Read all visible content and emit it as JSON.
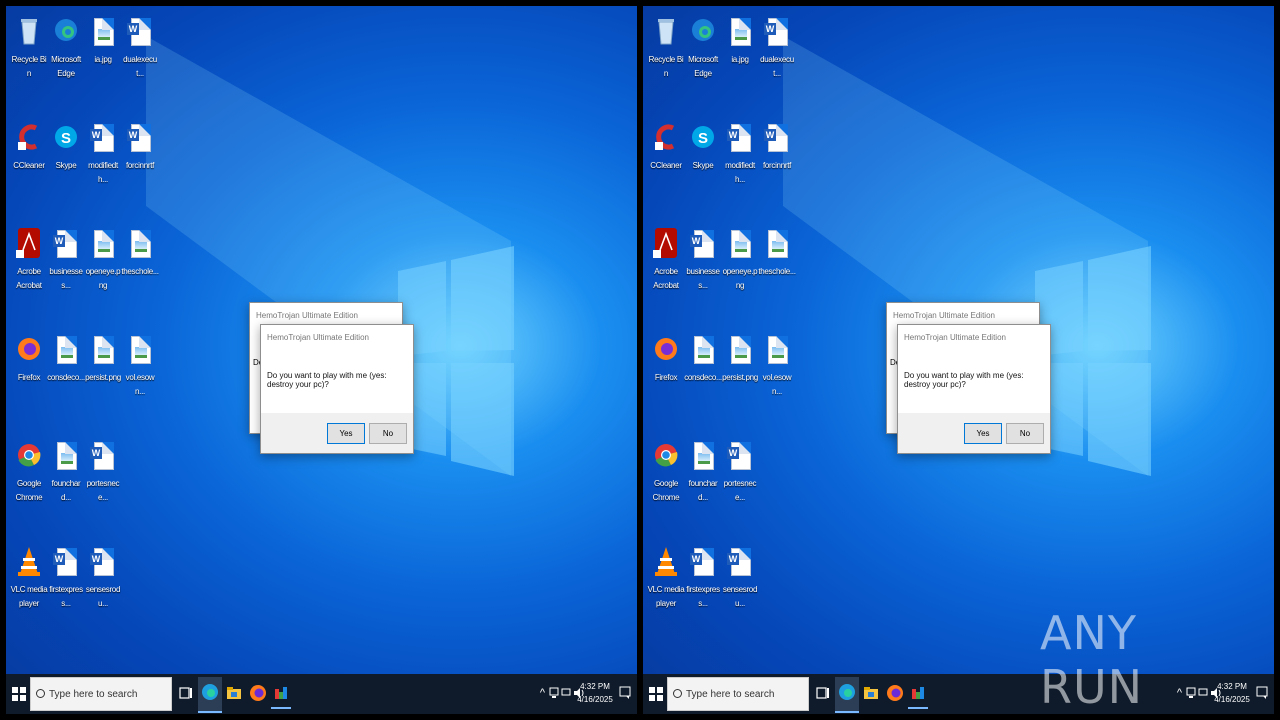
{
  "desktop_icons": [
    {
      "id": "recycle-bin",
      "lines": [
        "Recycle Bin"
      ],
      "icon": "recycle-bin-icon"
    },
    {
      "id": "edge",
      "lines": [
        "Microsoft",
        "Edge"
      ],
      "icon": "edge-icon"
    },
    {
      "id": "ia-jpg",
      "lines": [
        "ia.jpg"
      ],
      "icon": "image-file-icon"
    },
    {
      "id": "doc-dualexecut",
      "lines": [
        "dualexecut..."
      ],
      "icon": "word-file-icon"
    },
    {
      "id": "ccleaner",
      "lines": [
        "CCleaner"
      ],
      "icon": "ccleaner-icon"
    },
    {
      "id": "skype",
      "lines": [
        "Skype"
      ],
      "icon": "skype-icon"
    },
    {
      "id": "doc-modifiedth",
      "lines": [
        "modifiedth..."
      ],
      "icon": "word-file-icon"
    },
    {
      "id": "doc-forcing",
      "lines": [
        "forcinnrtf"
      ],
      "icon": "word-file-icon"
    },
    {
      "id": "acrobat",
      "lines": [
        "Acrobe",
        "Acrobat"
      ],
      "icon": "acrobat-icon"
    },
    {
      "id": "doc-businesses",
      "lines": [
        "businesses..."
      ],
      "icon": "word-file-icon"
    },
    {
      "id": "img-openeye",
      "lines": [
        "openeye.png"
      ],
      "icon": "image-file-icon"
    },
    {
      "id": "img-theschole",
      "lines": [
        "theschole..."
      ],
      "icon": "image-file-icon"
    },
    {
      "id": "firefox",
      "lines": [
        "Firefox"
      ],
      "icon": "firefox-icon"
    },
    {
      "id": "img-consdeco",
      "lines": [
        "consdeco..."
      ],
      "icon": "image-file-icon"
    },
    {
      "id": "img-persist",
      "lines": [
        "persist.png"
      ],
      "icon": "image-file-icon"
    },
    {
      "id": "img-vol",
      "lines": [
        "vol.esown..."
      ],
      "icon": "image-file-icon"
    },
    {
      "id": "chrome",
      "lines": [
        "Google",
        "Chrome"
      ],
      "icon": "chrome-icon"
    },
    {
      "id": "img-founchard",
      "lines": [
        "founchard..."
      ],
      "icon": "image-file-icon"
    },
    {
      "id": "doc-portes",
      "lines": [
        "portesnece..."
      ],
      "icon": "word-file-icon"
    },
    {
      "id": "vlc",
      "lines": [
        "VLC media",
        "player"
      ],
      "icon": "vlc-icon"
    },
    {
      "id": "doc-firstexpress",
      "lines": [
        "firstexpress..."
      ],
      "icon": "word-file-icon"
    },
    {
      "id": "doc-senses",
      "lines": [
        "sensesrodu..."
      ],
      "icon": "word-file-icon"
    }
  ],
  "dialog": {
    "back_title": "HemoTrojan Ultimate Edition",
    "back_peek": "De",
    "title": "HemoTrojan Ultimate Edition",
    "message": "Do you want to play with me (yes: destroy your pc)?",
    "yes_label": "Yes",
    "no_label": "No"
  },
  "taskbar": {
    "search_placeholder": "Type here to search",
    "time": "4:32 PM",
    "date": "4/16/2025"
  },
  "watermark": "ANY RUN",
  "colors": {
    "taskbar": "#0f1b2a",
    "desktop_accent": "#0a64d6"
  }
}
